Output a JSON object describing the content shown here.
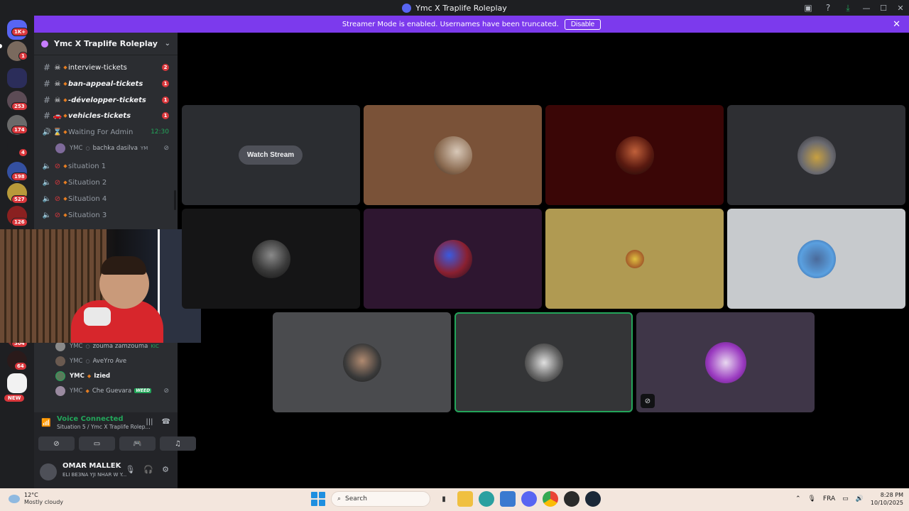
{
  "window": {
    "title": "Ymc X Traplife Roleplay",
    "icons": [
      "screen-share-icon",
      "help-icon",
      "download-icon",
      "minimize-icon",
      "maximize-icon",
      "close-icon"
    ]
  },
  "banner": {
    "message": "Streamer Mode is enabled. Usernames have been truncated.",
    "disable_label": "Disable",
    "close_glyph": "✕"
  },
  "rail": {
    "badges": [
      "1K+",
      "1",
      "253",
      "174",
      "4",
      "198",
      "527",
      "126",
      "304",
      "64"
    ],
    "new_label": "NEW"
  },
  "server": {
    "name": "Ymc X Traplife Roleplay"
  },
  "channels": [
    {
      "name": "interview-tickets",
      "count": "2"
    },
    {
      "name": "ban-appeal-tickets",
      "count": "1"
    },
    {
      "name": "-développer-tickets",
      "count": "1"
    },
    {
      "name": "vehicles-tickets",
      "count": "1"
    },
    {
      "name": "Waiting For Admin",
      "time": "12:30"
    },
    {
      "name": "situation 1"
    },
    {
      "name": "Situation 2"
    },
    {
      "name": "Situation 4"
    },
    {
      "name": "Situation 3"
    }
  ],
  "members_top": [
    {
      "tag": "YMC",
      "name": "bachka dasilva",
      "suffix": "YM"
    }
  ],
  "members_bottom": [
    {
      "tag": "YMC",
      "name": "zouma zamzouma",
      "extra": "KIC"
    },
    {
      "tag": "YMC",
      "name": "AveYro Ave"
    },
    {
      "tag": "YMC",
      "name": "Izied"
    },
    {
      "tag": "YMC",
      "name": "Che Guevara",
      "extra": "WEED"
    }
  ],
  "voice": {
    "status": "Voice Connected",
    "location": "Situation 5 / Ymc X Traplife Rolep..."
  },
  "user": {
    "name": "OMAR MALLEK",
    "status": "ELI BE3NA YJI NHAR W Y..."
  },
  "stage": {
    "watch_stream_label": "Watch Stream"
  },
  "taskbar": {
    "temperature": "12°C",
    "condition": "Mostly cloudy",
    "search_placeholder": "Search",
    "language": "FRA",
    "time": "8:28 PM",
    "date": "10/10/2025"
  },
  "colors": {
    "accent": "#7c3aed",
    "online": "#23a55a",
    "badge": "#da373c"
  }
}
